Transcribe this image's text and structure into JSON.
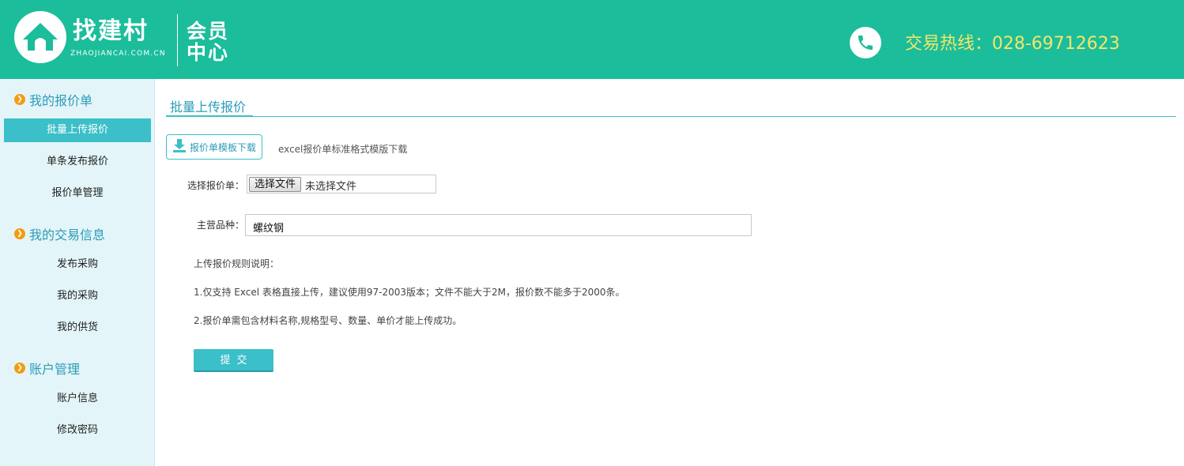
{
  "header": {
    "brand": "找建村",
    "domain": "ZHAOJIANCAI.COM.CN",
    "member_line1": "会员",
    "member_line2": "中心",
    "hotline": "交易热线：028-69712623"
  },
  "sidebar": {
    "sections": [
      {
        "title": "我的报价单",
        "items": [
          "批量上传报价",
          "单条发布报价",
          "报价单管理"
        ]
      },
      {
        "title": "我的交易信息",
        "items": [
          "发布采购",
          "我的采购",
          "我的供货"
        ]
      },
      {
        "title": "账户管理",
        "items": [
          "账户信息",
          "修改密码"
        ]
      }
    ],
    "active_item": "批量上传报价"
  },
  "main": {
    "title": "批量上传报价",
    "download_button": "报价单模板下载",
    "download_note": "excel报价单标准格式模版下载",
    "file_label": "选择报价单：",
    "file_button": "选择文件",
    "file_status": "未选择文件",
    "category_label": "主营品种：",
    "category_value": "螺纹钢",
    "rules_title": "上传报价规则说明：",
    "rule1": "1.仅支持 Excel 表格直接上传，建议使用97-2003版本；文件不能大于2M，报价数不能多于2000条。",
    "rule2": "2.报价单需包含材料名称,规格型号、数量、单价才能上传成功。",
    "submit": "提交"
  },
  "colors": {
    "header_bg": "#1bbd9b",
    "hotline": "#f5e56a",
    "accent": "#3bbfc8",
    "section_icon": "#f39c12",
    "sidebar_bg": "#e3f5f8"
  }
}
